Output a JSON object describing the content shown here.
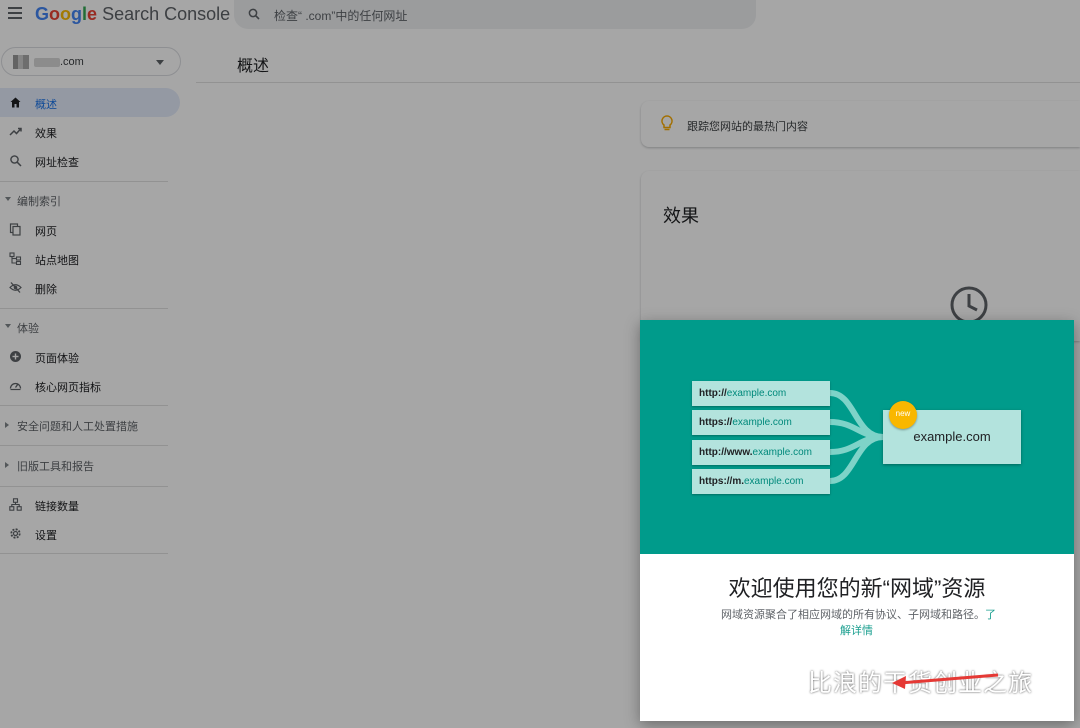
{
  "topbar": {
    "menu_icon": "hamburger-menu-icon",
    "logo_google": "Google",
    "logo_product": " Search Console",
    "search_placeholder": "检查“        .com”中的任何网址"
  },
  "sidebar": {
    "property": ".com",
    "items": [
      {
        "label": "概述",
        "icon": "home-icon",
        "active": true
      },
      {
        "label": "效果",
        "icon": "trending-up-icon"
      },
      {
        "label": "网址检查",
        "icon": "search-icon"
      }
    ],
    "section_index": "编制索引",
    "index_items": [
      {
        "label": "网页",
        "icon": "pages-icon"
      },
      {
        "label": "站点地图",
        "icon": "sitemap-icon"
      },
      {
        "label": "删除",
        "icon": "visibility-off-icon"
      }
    ],
    "section_experience": "体验",
    "experience_items": [
      {
        "label": "页面体验",
        "icon": "plus-circle-icon"
      },
      {
        "label": "核心网页指标",
        "icon": "speed-gauge-icon"
      }
    ],
    "section_security": "安全问题和人工处置措施",
    "section_legacy": "旧版工具和报告",
    "bottom_items": [
      {
        "label": "链接数量",
        "icon": "links-icon"
      },
      {
        "label": "设置",
        "icon": "settings-icon"
      }
    ]
  },
  "main": {
    "page_title": "概述",
    "tip": "跟踪您网站的最热门内容",
    "performance_title": "效果"
  },
  "dialog": {
    "urls": [
      {
        "scheme": "http://",
        "host": "example.com"
      },
      {
        "scheme": "https://",
        "host": "example.com"
      },
      {
        "scheme": "http://www.",
        "host": "example.com"
      },
      {
        "scheme": "https://m.",
        "host": "example.com"
      }
    ],
    "new_badge": "new",
    "domain": "example.com",
    "title": "欢迎使用您的新“网域”资源",
    "description": "网域资源聚合了相应网域的所有协议、子网域和路径。",
    "learn_more_part1": "了",
    "learn_more_part2": "解详情",
    "hero_color": "#009b8b"
  },
  "watermark": {
    "text": "比浪的干货创业之旅",
    "icon": "wechat-icon"
  }
}
